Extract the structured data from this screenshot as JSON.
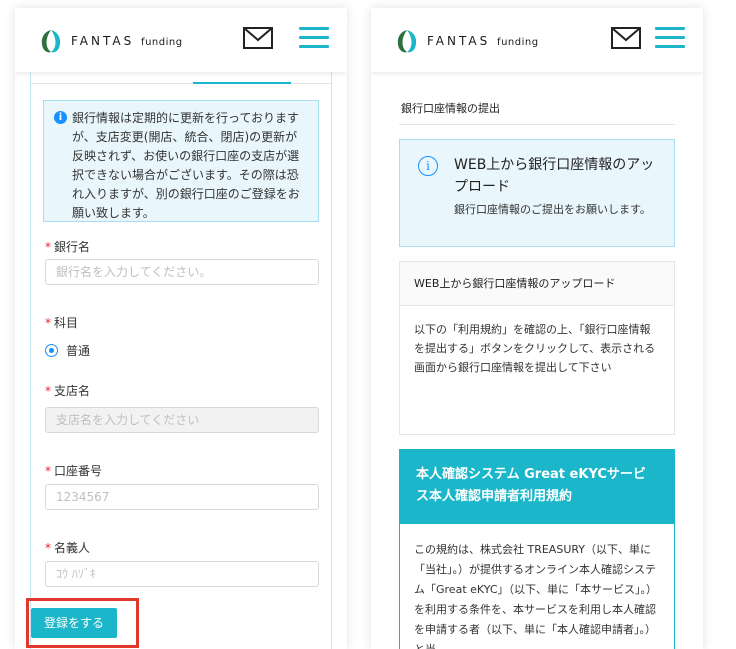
{
  "brand": {
    "name": "FANTAS",
    "suffix": "funding",
    "accent": "#1bb6c9"
  },
  "icons": {
    "mail": "mail-icon",
    "menu": "hamburger-menu-icon",
    "info": "info-icon"
  },
  "left": {
    "notice": "銀行情報は定期的に更新を行っておりますが、支店変更(開店、統合、閉店)の更新が反映されず、お使いの銀行口座の支店が選択できない場合がございます。その際は恐れ入りますが、別の銀行口座のご登録をお願い致します。",
    "bank_label": "銀行名",
    "bank_placeholder": "銀行名を入力してください。",
    "type_label": "科目",
    "type_option": "普通",
    "branch_label": "支店名",
    "branch_placeholder": "支店名を入力してください",
    "account_label": "口座番号",
    "account_placeholder": "1234567",
    "holder_label": "名義人",
    "holder_placeholder": "ｺｳ ﾊｿﾞｷ",
    "submit_label": "登録をする"
  },
  "right": {
    "section_title": "銀行口座情報の提出",
    "upload_title": "WEB上から銀行口座情報のアップロード",
    "upload_desc": "銀行口座情報のご提出をお願いします。",
    "card_head": "WEB上から銀行口座情報のアップロード",
    "card_body": "以下の「利用規約」を確認の上、「銀行口座情報を提出する」ボタンをクリックして、表示される画面から銀行口座情報を提出して下さい",
    "terms_title": "本人確認システム Great eKYCサービス本人確認申請者利用規約",
    "terms_body": "この規約は、株式会社 TREASURY（以下、単に「当社」。）が提供するオンライン本人確認システム「Great eKYC」（以下、単に「本サービス」。）を利用する条件を、本サービスを利用し本人確認を申請する者（以下、単に「本人確認申請者」。）と当"
  }
}
